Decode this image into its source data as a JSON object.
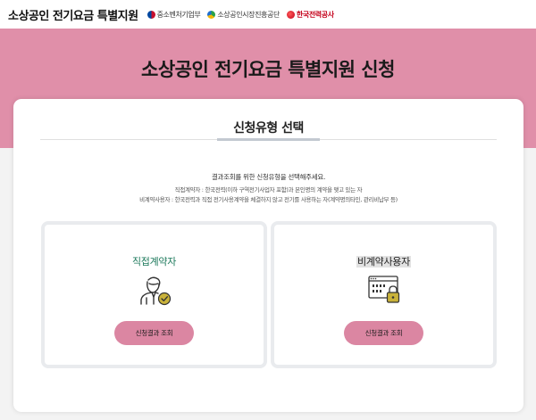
{
  "header": {
    "site_title": "소상공인 전기요금 특별지원",
    "partners": [
      {
        "label": "중소벤처기업부",
        "icon": "taegeuk-logo-icon"
      },
      {
        "label": "소상공인시장진흥공단",
        "icon": "semas-logo-icon"
      },
      {
        "label": "한국전력공사",
        "icon": "kepco-logo-icon"
      }
    ]
  },
  "banner": {
    "title": "소상공인 전기요금 특별지원 신청"
  },
  "main": {
    "section_title": "신청유형 선택",
    "guide": "결과조회를 위한 신청유형을 선택해주세요.",
    "definitions": [
      "직접계약자 : 한국전력(이하 구역전기사업자 포함)과 본인명의 계약을 맺고 있는 자",
      "비계약사용자 : 한국전력과 직접 전기사용계약을 체결하지 않고 전기를 사용하는 자(계약명의타인, 관리비납부 등)"
    ],
    "options": [
      {
        "label": "직접계약자",
        "button": "신청결과 조회",
        "icon": "contractor-check-icon"
      },
      {
        "label": "비계약사용자",
        "button": "신청결과 조회",
        "icon": "locked-data-icon"
      }
    ]
  },
  "colors": {
    "banner": "#e08fa9",
    "button": "#db86a2",
    "accent_green": "#1e7a5c",
    "lock_yellow": "#c9b23a"
  }
}
